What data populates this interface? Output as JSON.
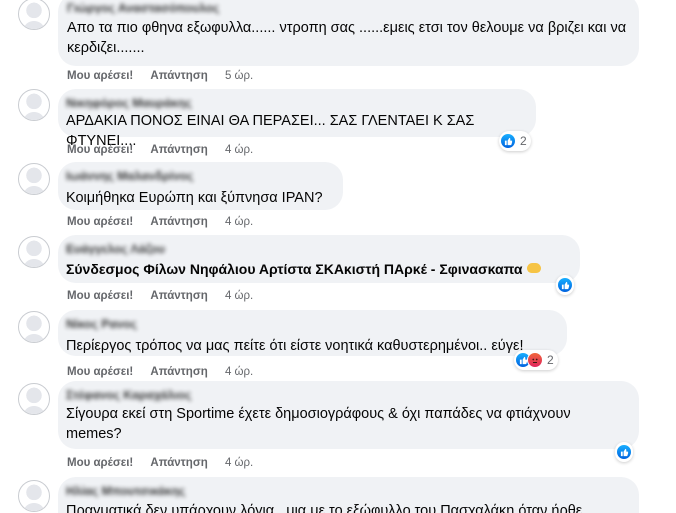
{
  "labels": {
    "like": "Μου αρέσει!",
    "reply": "Απάντηση"
  },
  "comments": [
    {
      "author": "Γιώργος Αναστασόπουλος",
      "text": "Απο τα πιο φθηνα εξωφυλλα...... ντροπη σας ......εμεις ετσι τον θελουμε να βριζει και να κερδιζει.......",
      "time": "5 ώρ."
    },
    {
      "author": "Νικηφόρος Μαυράκης",
      "text": "ΑΡΔΑΚΙΑ ΠΟΝΟΣ ΕΙΝΑΙ ΘΑ ΠΕΡΑΣΕΙ... ΣΑΣ ΓΛΕΝΤΑΕΙ Κ ΣΑΣ ΦΤΥΝΕΙ....",
      "time": "4 ώρ.",
      "reactions": {
        "types": [
          "like-icon"
        ],
        "count": "2"
      }
    },
    {
      "author": "Ιωάννης Μαλανδρίνος",
      "text": "Κοιμήθηκα Ευρώπη και ξύπνησα ΙΡΑΝ?",
      "time": "4 ώρ."
    },
    {
      "author": "Ευάγγελος Λάζου",
      "text": "Σύνδεσμος Φίλων Νηφάλιου Αρτίστα ΣΚΑκιστή ΠΑρκέ - Σφινασκαπα",
      "time": "4 ώρ.",
      "reactions": {
        "types": [
          "like-icon"
        ],
        "count": ""
      }
    },
    {
      "author": "Νίκος Ρανος",
      "text": "Περίεργος τρόπος να μας πείτε ότι είστε νοητικά καθυστερημένοι.. εύγε!",
      "time": "4 ώρ.",
      "reactions": {
        "types": [
          "like-icon",
          "angry-icon"
        ],
        "count": "2"
      }
    },
    {
      "author": "Στέφανος Καραχάλιος",
      "text": "Σίγουρα εκεί στη Sportime έχετε δημοσιογράφους & όχι παπάδες να φτιάχνουν memes?",
      "time": "4 ώρ.",
      "reactions": {
        "types": [
          "like-icon"
        ],
        "count": ""
      }
    },
    {
      "author": "Ηλίας Μπουτσικάκης",
      "text": "Πραγματικά δεν υπάρχουν λόγια...μια με το εξώφυλλο του Πασχαλάκη όταν ήρθε",
      "time": ""
    }
  ]
}
